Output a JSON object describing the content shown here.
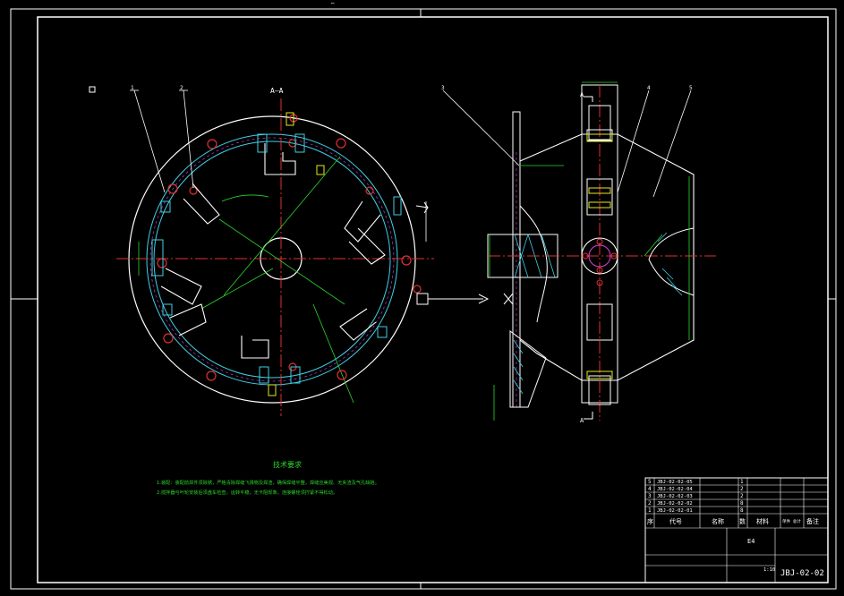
{
  "window": {
    "title": "…"
  },
  "section_label": "A—A",
  "section_marks": {
    "top": "A",
    "bottom": "A"
  },
  "balloons": [
    "1",
    "2",
    "3",
    "4",
    "5"
  ],
  "tech_req": {
    "title": "技术要求",
    "lines": [
      "1.装配：装配前焊件须除锈，严格清除焊缝飞溅物及焊渣，确保焊缝平整，焊缝应美观、无夹渣及气孔缺陷。",
      "2.搅拌器与叶轮安装后须盘车检查，运转平稳，无卡阻现象，连接螺栓须拧紧不得松动。"
    ]
  },
  "title_block": {
    "parts_rows": [
      [
        "5",
        "JBJ-02-02-05",
        "",
        "1",
        "",
        ""
      ],
      [
        "4",
        "JBJ-02-02-04",
        "",
        "2",
        "",
        ""
      ],
      [
        "3",
        "JBJ-02-02-03",
        "",
        "2",
        "",
        ""
      ],
      [
        "2",
        "JBJ-02-02-02",
        "",
        "8",
        "",
        ""
      ],
      [
        "1",
        "JBJ-02-02-01",
        "",
        "8",
        "",
        ""
      ]
    ],
    "header": [
      "序",
      "代号",
      "名称",
      "数",
      "材料",
      "单件 总计",
      "备注"
    ],
    "scale": "1:10",
    "sheet": "E4",
    "drawing_number": "JBJ-02-02"
  },
  "colors": {
    "background": "#000000",
    "white": "#ffffff",
    "green": "#2bd62b",
    "red": "#e23030",
    "cyan": "#3fd0e6",
    "magenta": "#e040e0",
    "yellow": "#e8e820"
  }
}
